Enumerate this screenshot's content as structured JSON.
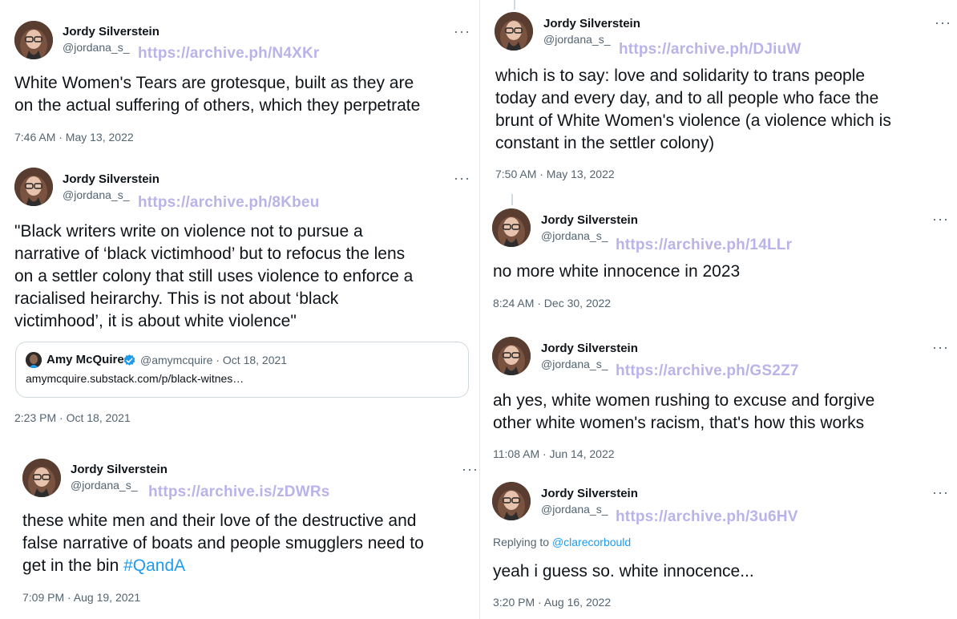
{
  "author": {
    "name": "Jordy Silverstein",
    "handle": "@jordana_s_"
  },
  "more_label": "···",
  "colors": {
    "archive_text": "#b9b3ea",
    "link_blue": "#1d9bf0",
    "secondary_text": "#536471"
  },
  "tweets": [
    {
      "archive": "https://archive.ph/N4XKr",
      "lines": [
        "White Women's Tears are grotesque, built as they are",
        "on the actual suffering of others, which they perpetrate"
      ],
      "time": "7:46 AM · May 13, 2022"
    },
    {
      "archive": "https://archive.ph/8Kbeu",
      "lines": [
        "\"Black writers write on violence not to pursue a",
        "narrative of ‘black victimhood’ but to refocus the lens",
        "on a settler colony that still uses violence to enforce a",
        "racialised heirarchy. This is not about ‘black",
        "victimhood’, it is about white violence\""
      ],
      "quote": {
        "name": "Amy McQuire",
        "meta": "@amymcquire · Oct 18, 2021",
        "link": "amymcquire.substack.com/p/black-witnes…"
      },
      "time": "2:23 PM · Oct 18, 2021"
    },
    {
      "archive": "https://archive.is/zDWRs",
      "lines": [
        "these white men and their love of the destructive and",
        "false narrative of boats and people smugglers need to",
        "get in the bin "
      ],
      "hashtag": "#QandA",
      "time": "7:09 PM · Aug 19, 2021"
    },
    {
      "archive": "https://archive.ph/DJiuW",
      "lines": [
        "which is to say: love and solidarity to trans people",
        "today and every day, and to all people who face the",
        "brunt of White Women's violence (a violence which is",
        "constant in the settler colony)"
      ],
      "time": "7:50 AM · May 13, 2022"
    },
    {
      "archive": "https://archive.ph/14LLr",
      "lines": [
        "no more white innocence in 2023"
      ],
      "time": "8:24 AM · Dec 30, 2022"
    },
    {
      "archive": "https://archive.ph/GS2Z7",
      "lines": [
        "ah yes, white women rushing to excuse and forgive",
        "other white women's racism, that's how this works"
      ],
      "time": "11:08 AM · Jun 14, 2022"
    },
    {
      "archive": "https://archive.ph/3u6HV",
      "reply_prefix": "Replying to ",
      "reply_to": "@clarecorbould",
      "lines": [
        "yeah i guess so. white innocence..."
      ],
      "time": "3:20 PM · Aug 16, 2022"
    }
  ]
}
